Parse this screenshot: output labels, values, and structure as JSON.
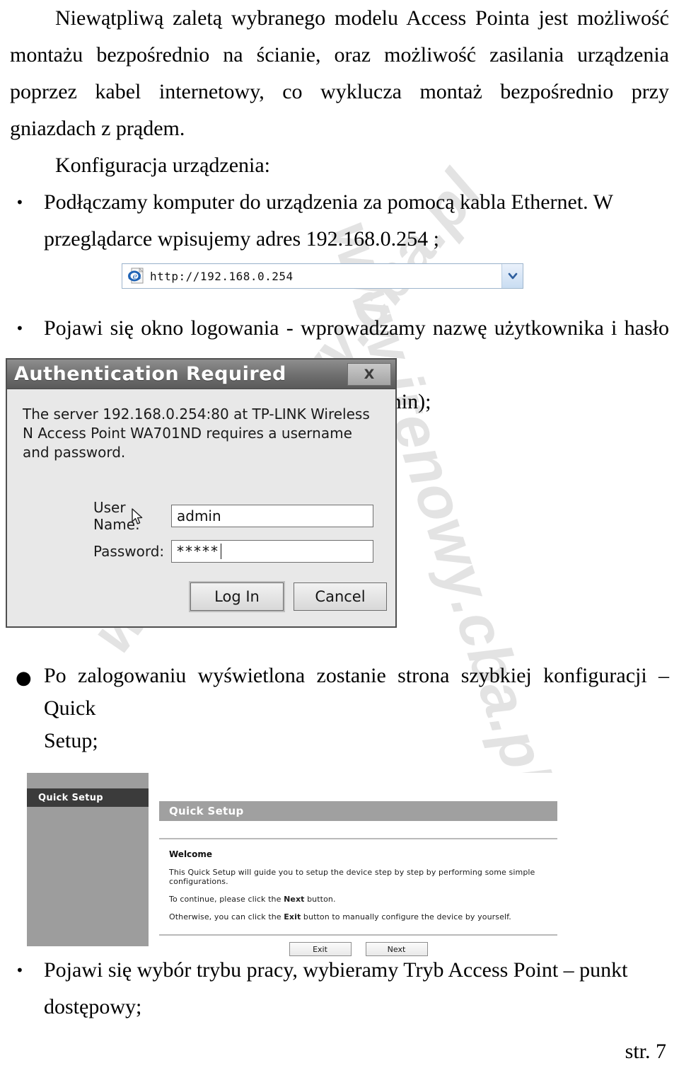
{
  "document": {
    "paragraphs": {
      "intro": "Niewątpliwą zaletą wybranego modelu Access Pointa jest możliwość montażu bezpośrednio na ścianie, oraz możliwość zasilania urządzenia poprzez kabel internetowy, co wyklucza montaż bezpośrednio przy gniazdach z prądem.",
      "subheading": "Konfiguracja urządzenia:"
    },
    "bullets": [
      {
        "marker": "•",
        "text_main": "Podłączamy komputer do urządzenia za pomocą kabla Ethernet. W",
        "text_tail": "przeglądarce wpisujemy adres 192.168.0.254 ;"
      },
      {
        "marker": "•",
        "text_main": "Pojawi się okno logowania - wprowadzamy nazwę użytkownika i hasło w",
        "text_tail": "odpowiednie pola (domyślnie admin, admin);"
      },
      {
        "marker": "●",
        "text_main": "Po zalogowaniu wyświetlona zostanie strona szybkiej konfiguracji – Quick",
        "text_tail": "Setup;"
      },
      {
        "marker": "•",
        "text_main": "Pojawi się wybór trybu pracy, wybieramy Tryb Access Point – punkt",
        "text_tail": "dostępowy;"
      }
    ],
    "footer": "str. 7",
    "watermark_text": "www.irenowy.cba.pl"
  },
  "address_bar": {
    "icon": "internet-explorer-icon",
    "url": "http://192.168.0.254",
    "dropdown_icon": "chevron-down-icon"
  },
  "auth_dialog": {
    "title": "Authentication Required",
    "close_label": "X",
    "message": "The server 192.168.0.254:80 at TP-LINK Wireless N Access Point WA701ND requires a username and password.",
    "username_label": "User Name:",
    "username_value": "admin",
    "password_label": "Password:",
    "password_value": "*****",
    "login_button": "Log In",
    "cancel_button": "Cancel"
  },
  "quick_setup": {
    "sidebar_items": [
      "Quick Setup"
    ],
    "panel_title": "Quick Setup",
    "welcome_heading": "Welcome",
    "line1": "This Quick Setup will guide you to setup the device step by step by performing some simple configurations.",
    "line2_before": "To continue, please click the ",
    "line2_bold": "Next",
    "line2_after": " button.",
    "line3_before": "Otherwise, you can click the ",
    "line3_bold": "Exit",
    "line3_after": " button to manually configure the device by yourself.",
    "exit_button": "Exit",
    "next_button": "Next"
  },
  "colors": {
    "sidebar_bg": "#9d9d9d",
    "sidebar_active": "#3b3b3b",
    "panel_header": "#a0a0a0",
    "dialog_titlebar": "#6e6e6e",
    "dialog_bg": "#e8e8e8",
    "watermark": "#e3e3e3"
  }
}
